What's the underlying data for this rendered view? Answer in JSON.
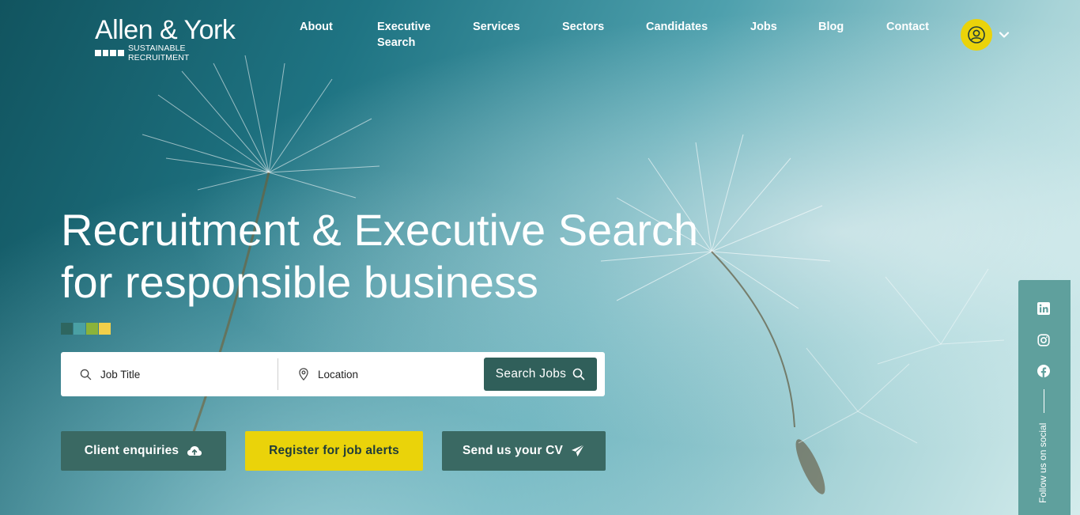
{
  "brand": {
    "name": "Allen & York",
    "tagline": "SUSTAINABLE RECRUITMENT"
  },
  "nav": {
    "items": [
      {
        "label": "About"
      },
      {
        "label": "Executive Search"
      },
      {
        "label": "Services"
      },
      {
        "label": "Sectors"
      },
      {
        "label": "Candidates"
      },
      {
        "label": "Jobs"
      },
      {
        "label": "Blog"
      },
      {
        "label": "Contact"
      }
    ],
    "account_icon": "user-circle-icon",
    "dropdown_icon": "chevron-down-icon"
  },
  "hero": {
    "title_line1": "Recruitment & Executive Search",
    "title_line2": "for responsible business",
    "swatch_colors": [
      "#2e6660",
      "#4aa0a4",
      "#8bb33a",
      "#f2cf4a"
    ]
  },
  "search": {
    "job_title_placeholder": "Job Title",
    "location_placeholder": "Location",
    "button_label": "Search Jobs"
  },
  "cta": {
    "client_enquiries": "Client enquiries",
    "register_alerts": "Register for job alerts",
    "send_cv": "Send us your CV"
  },
  "social": {
    "label": "Follow us on social",
    "icons": [
      "linkedin-icon",
      "instagram-icon",
      "facebook-icon"
    ]
  },
  "colors": {
    "accent_yellow": "#ead30a",
    "button_dark": "#3a6963",
    "social_panel": "#5fa09d"
  }
}
